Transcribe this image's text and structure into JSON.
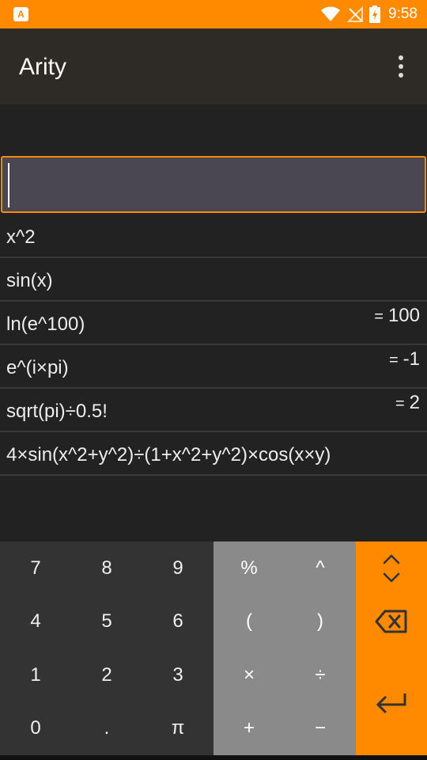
{
  "status_bar": {
    "notification_icon_label": "A",
    "time": "9:58"
  },
  "app_bar": {
    "title": "Arity",
    "overflow_icon": "more-vert-icon"
  },
  "input": {
    "value": "",
    "placeholder": ""
  },
  "history": [
    {
      "expression": "x^2",
      "result_prefix": "",
      "result": ""
    },
    {
      "expression": "sin(x)",
      "result_prefix": "",
      "result": ""
    },
    {
      "expression": "ln(e^100)",
      "result_prefix": "=",
      "result": "100"
    },
    {
      "expression": "e^(i×pi)",
      "result_prefix": "=",
      "result": "-1"
    },
    {
      "expression": "sqrt(pi)÷0.5!",
      "result_prefix": "=",
      "result": "2"
    },
    {
      "expression": "4×sin(x^2+y^2)÷(1+x^2+y^2)×cos(x×y)",
      "result_prefix": "",
      "result": ""
    }
  ],
  "keypad": {
    "numbers": [
      "7",
      "8",
      "9",
      "4",
      "5",
      "6",
      "1",
      "2",
      "3",
      "0",
      ".",
      "π"
    ],
    "operators": [
      "%",
      "^",
      "(",
      ")",
      "×",
      "÷",
      "+",
      "−"
    ],
    "side_icons": [
      "expand-collapse-icon",
      "backspace-icon",
      "enter-icon"
    ]
  },
  "colors": {
    "accent": "#ff8a00",
    "app_bar": "#2e2a26",
    "background": "#222222",
    "input_fill": "#4a4752",
    "number_pad": "#333333",
    "operator_pad": "#8a8a8a"
  }
}
